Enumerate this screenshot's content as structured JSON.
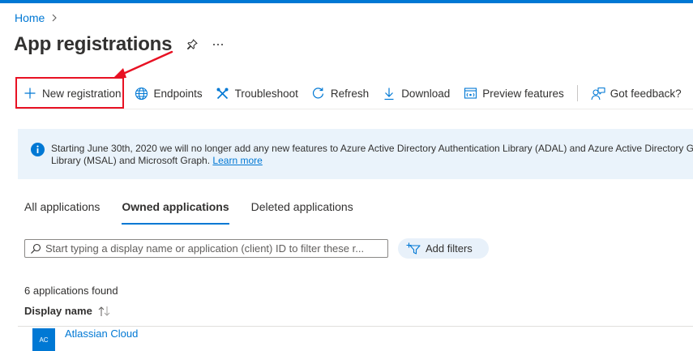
{
  "breadcrumb": {
    "home": "Home",
    "separator_icon": "chevron-right-icon"
  },
  "page": {
    "title": "App registrations",
    "pin_icon": "pin-icon",
    "more_icon": "more-icon"
  },
  "toolbar": {
    "new_registration": "New registration",
    "endpoints": "Endpoints",
    "troubleshoot": "Troubleshoot",
    "refresh": "Refresh",
    "download": "Download",
    "preview_features": "Preview features",
    "feedback": "Got feedback?"
  },
  "banner": {
    "line1": "Starting June 30th, 2020 we will no longer add any new features to Azure Active Directory Authentication Library (ADAL) and Azure Active Directory Gr",
    "line2": "Library (MSAL) and Microsoft Graph.",
    "link": "Learn more"
  },
  "tabs": [
    {
      "label": "All applications",
      "active": false
    },
    {
      "label": "Owned applications",
      "active": true
    },
    {
      "label": "Deleted applications",
      "active": false
    }
  ],
  "search": {
    "placeholder": "Start typing a display name or application (client) ID to filter these r...",
    "value": ""
  },
  "filters": {
    "add_label": "Add filters"
  },
  "results": {
    "count_text": "6 applications found",
    "column_display_name": "Display name"
  },
  "rows": [
    {
      "initials": "AC",
      "name": "Atlassian Cloud"
    }
  ],
  "colors": {
    "accent": "#0078d4",
    "highlight": "#e81123",
    "banner_bg": "#eaf3fb"
  }
}
